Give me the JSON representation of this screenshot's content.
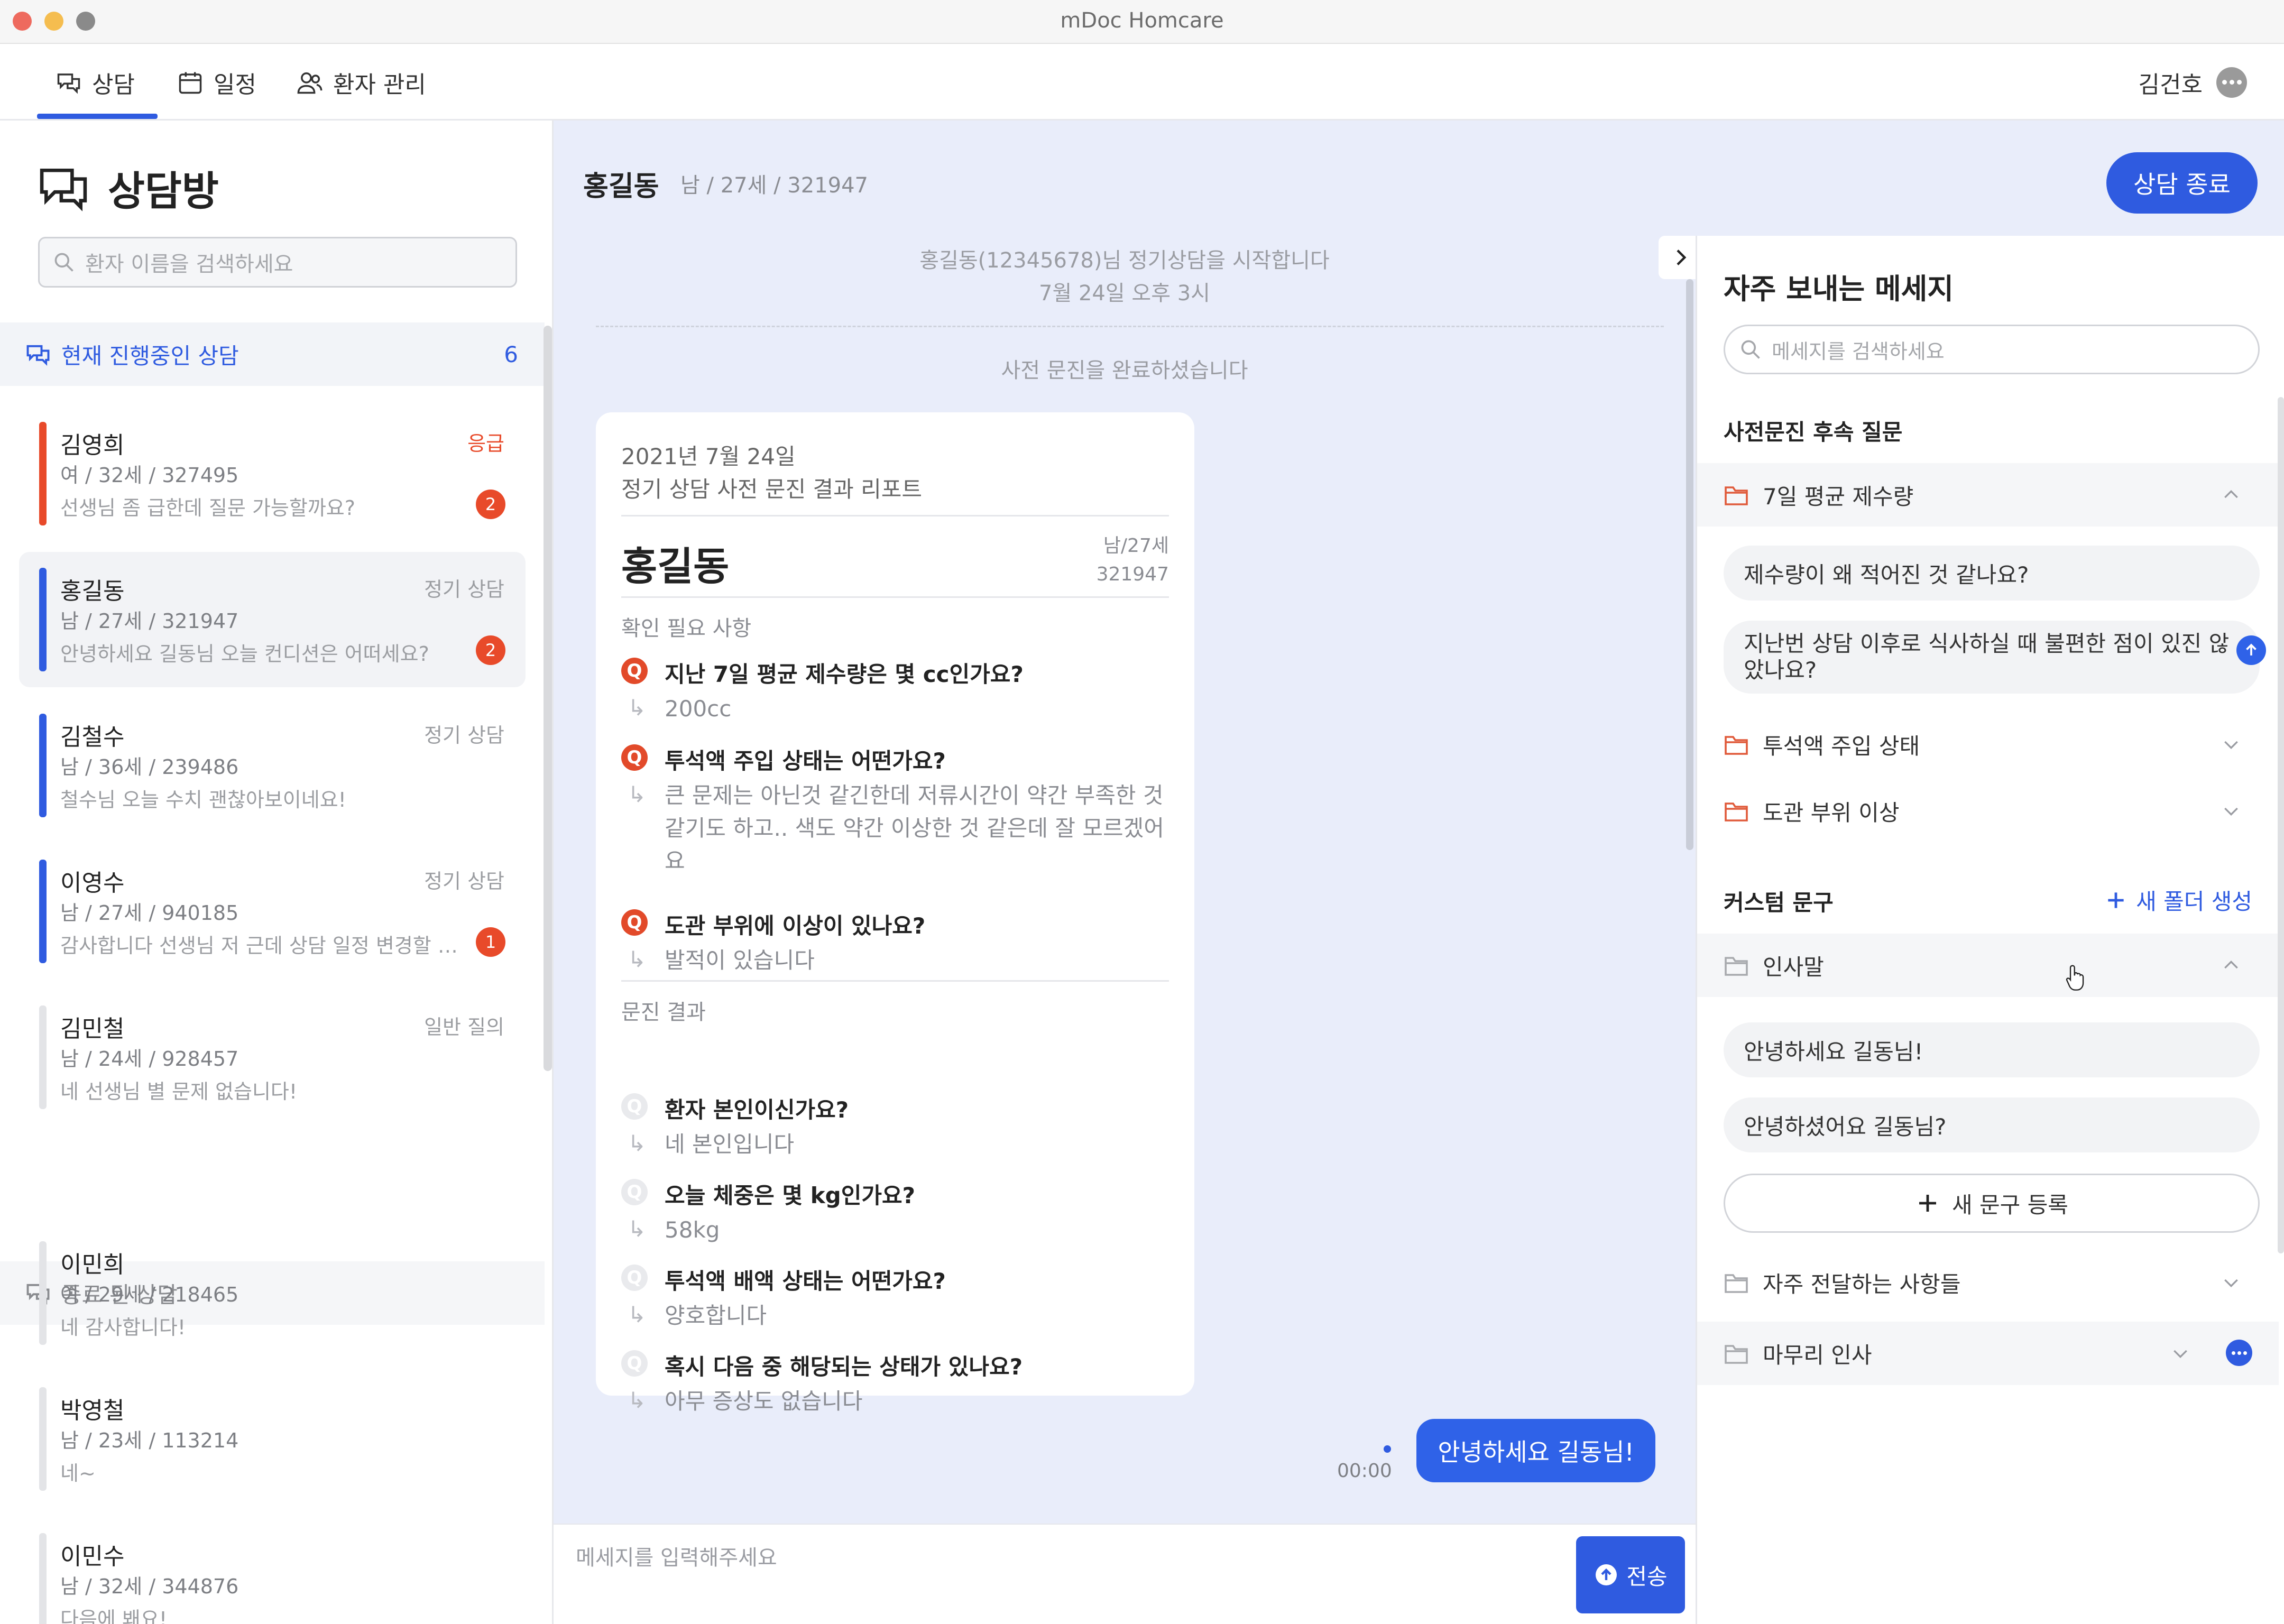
{
  "window": {
    "title": "mDoc Homcare"
  },
  "nav": {
    "tabs": [
      {
        "label": "상담",
        "icon": "chat-icon",
        "active": true
      },
      {
        "label": "일정",
        "icon": "calendar-icon"
      },
      {
        "label": "환자 관리",
        "icon": "users-icon"
      }
    ],
    "user_name": "김건호",
    "accent": "#2f5be0"
  },
  "sidebar": {
    "title": "상담방",
    "search_placeholder": "환자 이름을 검색하세요",
    "active_section": {
      "label": "현재 진행중인 상담",
      "count": "6"
    },
    "active": [
      {
        "name": "김영희",
        "meta": "여 / 32세 / 327495",
        "preview": "선생님 좀 급한데 질문 가능할까요?",
        "tag": "응급",
        "badge": "2",
        "bar_color": "#e84a2a",
        "tag_color": "#e84a2a"
      },
      {
        "name": "홍길동",
        "meta": "남 / 27세 / 321947",
        "preview": "안녕하세요 길동님 오늘 컨디션은 어떠세요?",
        "tag": "정기 상담",
        "badge": "2",
        "bar_color": "#2f5be0",
        "selected": true
      },
      {
        "name": "김철수",
        "meta": "남 / 36세 / 239486",
        "preview": "철수님 오늘 수치 괜찮아보이네요!",
        "tag": "정기 상담",
        "bar_color": "#2f5be0"
      },
      {
        "name": "이영수",
        "meta": "남 / 27세 / 940185",
        "preview": "감사합니다 선생님 저 근데 상담 일정 변경할 수 있을까요?",
        "tag": "정기 상담",
        "badge": "1",
        "bar_color": "#2f5be0"
      },
      {
        "name": "김민철",
        "meta": "남 / 24세 / 928457",
        "preview": "네 선생님 별 문제 없습니다!",
        "tag": "일반 질의",
        "bar_color": "#e3e4e7"
      }
    ],
    "closed_section": {
      "label": "종료 된 상담"
    },
    "closed": [
      {
        "name": "이민희",
        "meta": "여 / 29세 / 218465",
        "preview": "네 감사합니다!",
        "bar_color": "#e3e4e7"
      },
      {
        "name": "박영철",
        "meta": "남 / 23세 / 113214",
        "preview": "네~",
        "bar_color": "#e3e4e7"
      },
      {
        "name": "이민수",
        "meta": "남 / 32세 / 344876",
        "preview": "다음에 봬요!",
        "bar_color": "#e3e4e7"
      }
    ]
  },
  "chat": {
    "patient_name": "홍길동",
    "patient_info": "남 / 27세 / 321947",
    "end_button": "상담 종료",
    "system_start": "홍길동(12345678)님 정기상담을 시작합니다",
    "system_time": "7월 24일 오후 3시",
    "system_done": "사전 문진을 완료하셨습니다",
    "report": {
      "date": "2021년 7월 24일",
      "subtitle": "정기 상담 사전 문진 결과 리포트",
      "name": "홍길동",
      "meta1": "남/27세",
      "meta2": "321947",
      "section1": "확인 필요 사항",
      "items1": [
        {
          "q": "지난 7일 평균 제수량은 몇 cc인가요?",
          "a": "200cc"
        },
        {
          "q": "투석액 주입 상태는 어떤가요?",
          "a": "큰 문제는 아닌것 같긴한데 저류시간이 약간 부족한 것 같기도 하고.. 색도 약간 이상한 것 같은데 잘 모르겠어요"
        },
        {
          "q": "도관 부위에 이상이 있나요?",
          "a": "발적이 있습니다"
        }
      ],
      "section2": "문진 결과",
      "items2": [
        {
          "q": "환자 본인이신가요?",
          "a": "네 본인입니다"
        },
        {
          "q": "오늘 체중은 몇 kg인가요?",
          "a": "58kg"
        },
        {
          "q": "투석액 배액 상태는 어떤가요?",
          "a": "양호합니다"
        },
        {
          "q": "혹시 다음 중 해당되는 상태가 있나요?",
          "a": "아무 증상도 없습니다"
        }
      ],
      "q_mark": "Q",
      "answer_arrow": "↳"
    },
    "my_message": "안녕하세요 길동님!",
    "my_message_time": "00:00",
    "input_placeholder": "메세지를 입력해주세요",
    "send_label": "전송"
  },
  "quick": {
    "title": "자주 보내는 메세지",
    "search_placeholder": "메세지를 검색하세요",
    "section1": "사전문진 후속 질문",
    "folders1": [
      {
        "label": "7일 평균 제수량",
        "open": true,
        "snippets": [
          "제수량이 왜 적어진 것 같나요?",
          "지난번 상담 이후로 식사하실 때 불편한 점이 있진 않았나요?"
        ]
      },
      {
        "label": "투석액 주입 상태"
      },
      {
        "label": "도관 부위 이상"
      }
    ],
    "section2": "커스텀 문구",
    "new_folder": "새 폴더 생성",
    "folders2": [
      {
        "label": "인사말",
        "open": true,
        "snippets": [
          "안녕하세요 길동님!",
          "안녕하셨어요 길동님?"
        ]
      },
      {
        "label": "자주 전달하는 사항들"
      },
      {
        "label": "마무리 인사"
      }
    ],
    "new_phrase": "새 문구 등록"
  }
}
